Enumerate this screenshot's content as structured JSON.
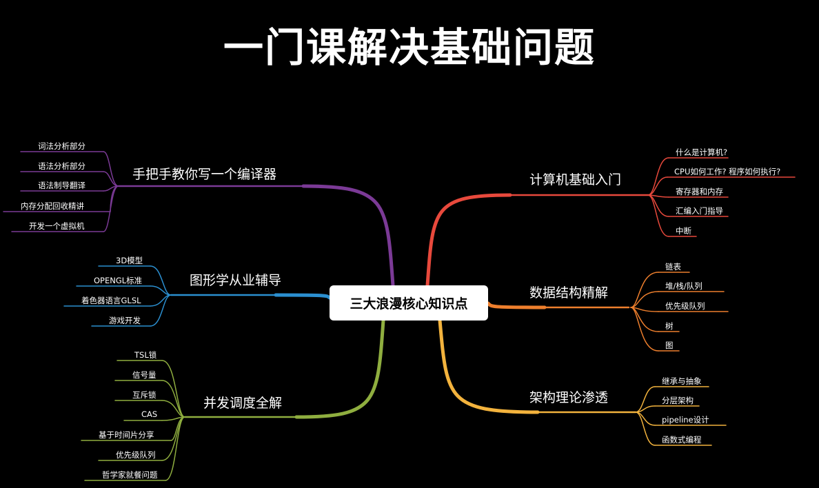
{
  "title": "一门课解决基础问题",
  "center": "三大浪漫核心知识点",
  "branches": {
    "computer": {
      "label": "计算机基础入门",
      "color": "#e8493c",
      "leaves": [
        "什么是计算机?",
        "CPU如何工作? 程序如何执行?",
        "寄存器和内存",
        "汇编入门指导",
        "中断"
      ]
    },
    "datastruct": {
      "label": "数据结构精解",
      "color": "#ee7f2d",
      "leaves": [
        "链表",
        "堆/栈/队列",
        "优先级队列",
        "树",
        "图"
      ]
    },
    "arch": {
      "label": "架构理论渗透",
      "color": "#f3b33d",
      "leaves": [
        "继承与抽象",
        "分层架构",
        "pipeline设计",
        "函数式编程"
      ]
    },
    "compiler": {
      "label": "手把手教你写一个编译器",
      "color": "#7b3a96",
      "leaves": [
        "词法分析部分",
        "语法分析部分",
        "语法制导翻译",
        "内存分配回收精讲",
        "开发一个虚拟机"
      ]
    },
    "graphics": {
      "label": "图形学从业辅导",
      "color": "#2b8fd0",
      "leaves": [
        "3D模型",
        "OPENGL标准",
        "着色器语言GLSL",
        "游戏开发"
      ]
    },
    "concurrency": {
      "label": "并发调度全解",
      "color": "#8fae3f",
      "leaves": [
        "TSL锁",
        "信号量",
        "互斥锁",
        "CAS",
        "基于时间片分享",
        "优先级队列",
        "哲学家就餐问题"
      ]
    }
  }
}
